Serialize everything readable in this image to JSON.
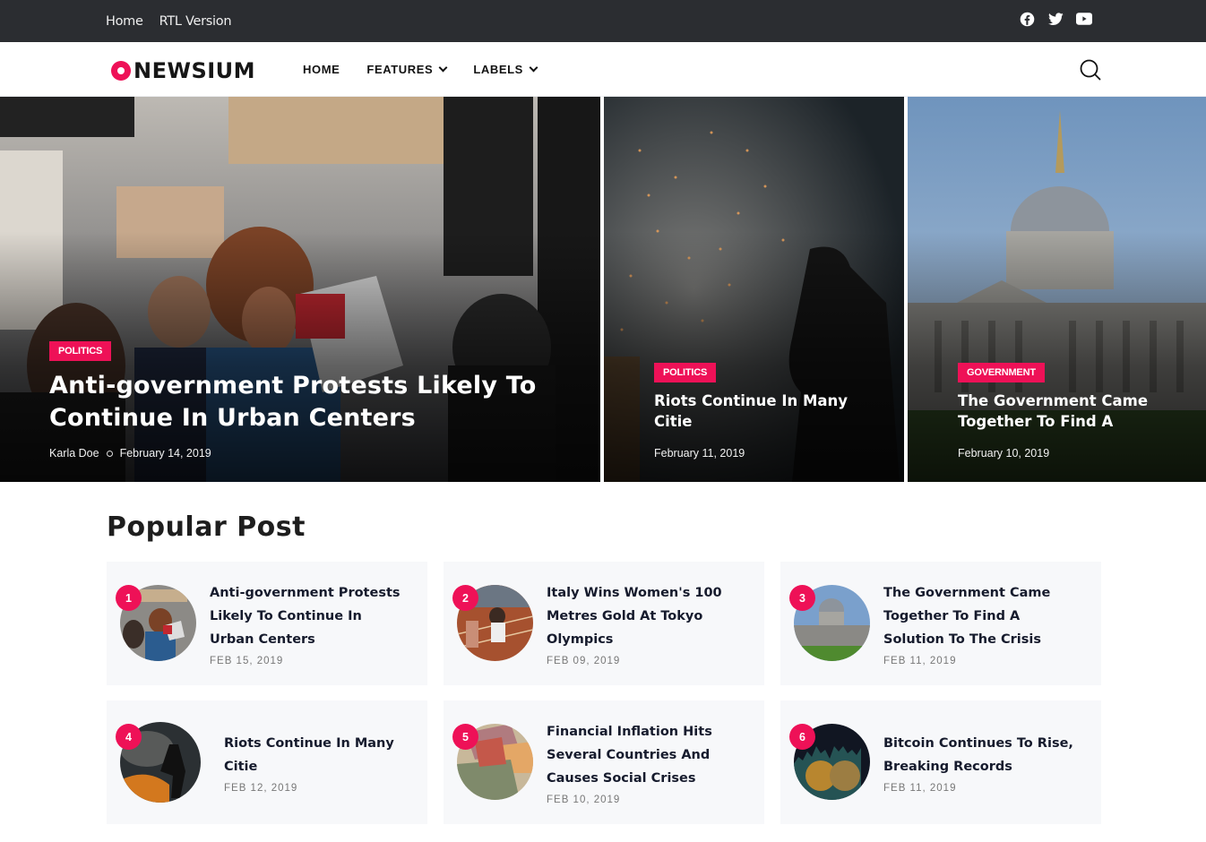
{
  "topbar": {
    "links": [
      "Home",
      "RTL Version"
    ],
    "social": [
      "facebook-icon",
      "twitter-icon",
      "youtube-icon"
    ]
  },
  "header": {
    "logo_text": "NEWSIUM",
    "nav": [
      {
        "label": "HOME",
        "has_dropdown": false
      },
      {
        "label": "FEATURES",
        "has_dropdown": true
      },
      {
        "label": "LABELS",
        "has_dropdown": true
      }
    ],
    "search_icon": "search-icon"
  },
  "colors": {
    "accent": "#ee1157",
    "topbar_bg": "#2b2d31",
    "card_bg": "#f7f8fa",
    "title_text": "#161b2d"
  },
  "hero": [
    {
      "category": "POLITICS",
      "title": "Anti-government Protests Likely To Continue In Urban Centers",
      "author": "Karla Doe",
      "date": "February 14, 2019"
    },
    {
      "category": "POLITICS",
      "title": "Riots Continue In Many Citie",
      "date": "February 11, 2019"
    },
    {
      "category": "GOVERNMENT",
      "title": "The Government Came Together To Find A",
      "date": "February 10, 2019"
    }
  ],
  "popular": {
    "title": "Popular Post",
    "posts": [
      {
        "rank": "1",
        "title": "Anti-government Protests Likely To Continue In Urban Centers",
        "date": "FEB 15, 2019"
      },
      {
        "rank": "2",
        "title": "Italy Wins Women's 100 Metres Gold At Tokyo Olympics",
        "date": "FEB 09, 2019"
      },
      {
        "rank": "3",
        "title": "The Government Came Together To Find A Solution To The Crisis",
        "date": "FEB 11, 2019"
      },
      {
        "rank": "4",
        "title": "Riots Continue In Many Citie",
        "date": "FEB 12, 2019"
      },
      {
        "rank": "5",
        "title": "Financial Inflation Hits Several Countries And Causes Social Crises",
        "date": "FEB 10, 2019"
      },
      {
        "rank": "6",
        "title": "Bitcoin Continues To Rise, Breaking Records",
        "date": "FEB 11, 2019"
      }
    ]
  }
}
